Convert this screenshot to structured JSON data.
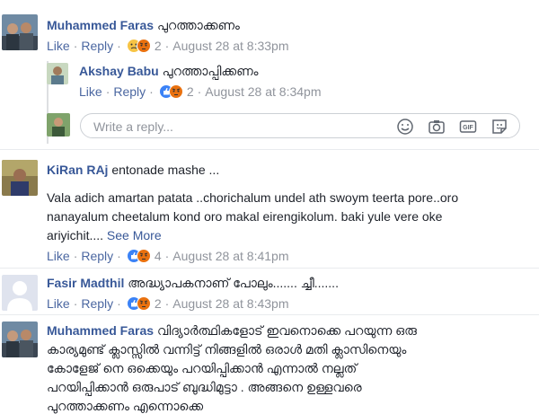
{
  "comments": [
    {
      "name": "Muhammed Faras",
      "text": "പുറത്താക്കണം",
      "like_label": "Like",
      "reply_label": "Reply",
      "reaction_count": "2",
      "time": "August 28 at 8:33pm",
      "reactions": [
        "sad",
        "angry"
      ]
    },
    {
      "name": "Akshay Babu",
      "text": "പുറത്താപ്പിക്കണം",
      "like_label": "Like",
      "reply_label": "Reply",
      "reaction_count": "2",
      "time": "August 28 at 8:34pm",
      "reactions": [
        "like",
        "angry"
      ]
    },
    {
      "name": "KiRan RAj",
      "text": "entonade mashe ...",
      "body_lines": [
        "Vala adich amartan patata ..chorichalum undel ath swoym teerta pore..oro",
        "nanayalum cheetalum kond oro makal eirengikolum. baki yule vere oke",
        "ariyichit...."
      ],
      "see_more": "See More",
      "like_label": "Like",
      "reply_label": "Reply",
      "reaction_count": "4",
      "time": "August 28 at 8:41pm",
      "reactions": [
        "like",
        "angry"
      ]
    },
    {
      "name": "Fasir Madthil",
      "text": "അദ്ധ്യാപകനാണ് പോലും....... ച്ചീ.......",
      "like_label": "Like",
      "reply_label": "Reply",
      "reaction_count": "2",
      "time": "August 28 at 8:43pm",
      "reactions": [
        "like",
        "angry"
      ]
    },
    {
      "name": "Muhammed Faras",
      "text": "വിദ്യാർത്ഥികളോട് ഇവനൊക്കെ പറയുന്ന ഒരു",
      "body_lines": [
        "കാര്യമുണ്ട് ക്ലാസ്സിൽ വന്നിട്ട് നിങ്ങളിൽ ഒരാൾ മതി ക്ലാസിനെയും",
        "കോളേജ് നെ ഒക്കെയും പറയിപ്പിക്കാൻ എന്നാൽ നല്ലത്",
        "പറയിപ്പിക്കാൻ ഒരുപാട് ബുദ്ധിമുട്ടാ . അങ്ങനെ ഉള്ളവരെ",
        "പുറത്താക്കണം എന്നൊക്കെ"
      ]
    }
  ],
  "reply_box": {
    "placeholder": "Write a reply...",
    "icons": [
      "emoji-icon",
      "camera-icon",
      "gif-icon",
      "sticker-icon"
    ]
  },
  "colors": {
    "link": "#385898",
    "meta_gray": "#90949c",
    "like_blue": "#3b82f6",
    "angry_orange": "#e9710f",
    "sad_yellow": "#f7c445"
  }
}
